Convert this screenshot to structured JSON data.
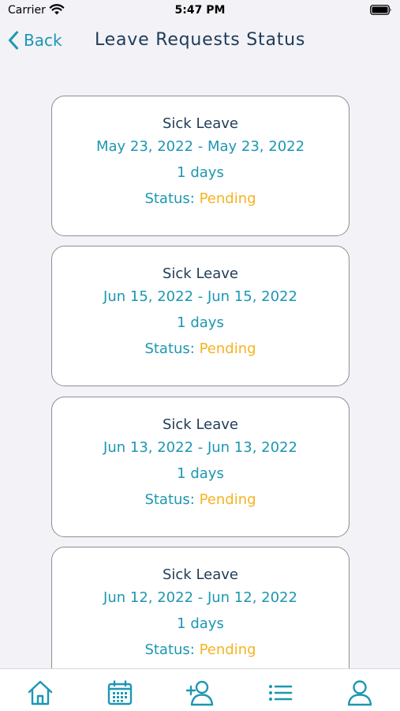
{
  "status_bar": {
    "carrier": "Carrier",
    "time": "5:47 PM"
  },
  "nav": {
    "back_label": "Back",
    "title": "Leave Requests Status"
  },
  "colors": {
    "accent": "#1c97b2",
    "title": "#1f3b57",
    "pending": "#f5b320",
    "background": "#f2f2f7"
  },
  "requests": [
    {
      "type": "Sick Leave",
      "range": "May 23, 2022 - May 23, 2022",
      "days": "1 days",
      "status_label": "Status:",
      "status_value": "Pending"
    },
    {
      "type": "Sick Leave",
      "range": "Jun 15, 2022 - Jun 15, 2022",
      "days": "1 days",
      "status_label": "Status:",
      "status_value": "Pending"
    },
    {
      "type": "Sick Leave",
      "range": "Jun 13, 2022 - Jun 13, 2022",
      "days": "1 days",
      "status_label": "Status:",
      "status_value": "Pending"
    },
    {
      "type": "Sick Leave",
      "range": "Jun 12, 2022 - Jun 12, 2022",
      "days": "1 days",
      "status_label": "Status:",
      "status_value": "Pending"
    }
  ],
  "tab_bar": {
    "tabs": [
      {
        "icon": "home-icon"
      },
      {
        "icon": "calendar-icon"
      },
      {
        "icon": "add-person-icon"
      },
      {
        "icon": "list-icon"
      },
      {
        "icon": "profile-icon"
      }
    ]
  }
}
